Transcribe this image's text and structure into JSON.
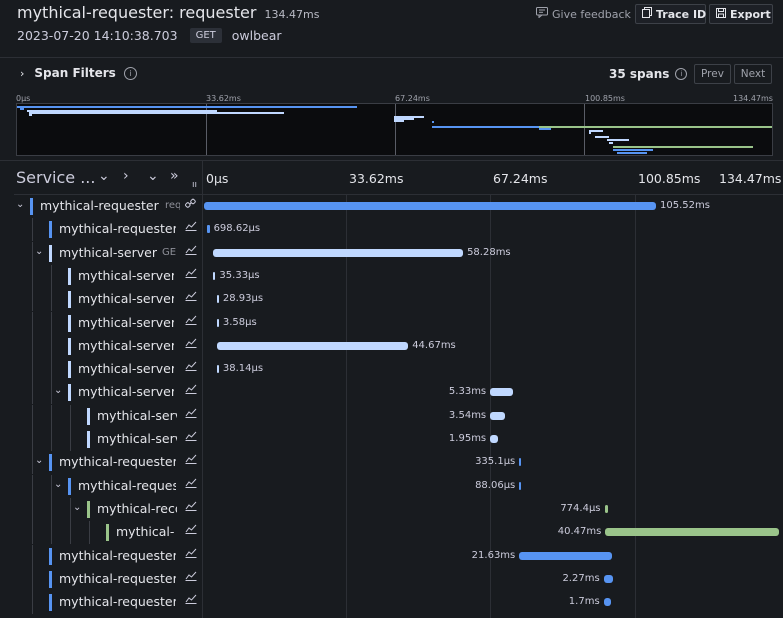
{
  "header": {
    "title": "mythical-requester: requester",
    "duration": "134.47ms",
    "timestamp": "2023-07-20 14:10:38.703",
    "method": "GET",
    "service_tag": "owlbear",
    "feedback_label": "Give feedback",
    "trace_id_label": "Trace ID",
    "export_label": "Export"
  },
  "filters": {
    "label": "Span Filters",
    "span_count": "35 spans",
    "prev_label": "Prev",
    "next_label": "Next"
  },
  "minimap_ticks": [
    "0μs",
    "33.62ms",
    "67.24ms",
    "100.85ms",
    "134.47ms"
  ],
  "columns": {
    "service_title": "Service ...",
    "ticks": [
      "0μs",
      "33.62ms",
      "67.24ms",
      "100.85ms",
      "134.47ms"
    ]
  },
  "colors": {
    "requester": "#5794f2",
    "server": "#c0d8ff",
    "recorder": "#9ac48a"
  },
  "rows": [
    {
      "service": "mythical-requester",
      "operation": "requester",
      "duration": "105.52ms",
      "color": "#5794f2",
      "start_ms": 0,
      "expanded": true,
      "icon": "link-icon"
    },
    {
      "service": "mythical-requester",
      "operation": "",
      "duration": "698.62μs",
      "color": "#5794f2",
      "start_ms": 0.6,
      "icon": "chart-icon"
    },
    {
      "service": "mythical-server",
      "operation": "GE",
      "duration": "58.28ms",
      "color": "#c0d8ff",
      "start_ms": 2.2,
      "expanded": true,
      "icon": "chart-icon"
    },
    {
      "service": "mythical-server",
      "operation": "",
      "duration": "35.33μs",
      "color": "#c0d8ff",
      "start_ms": 2.2,
      "icon": "chart-icon"
    },
    {
      "service": "mythical-server",
      "operation": "",
      "duration": "28.93μs",
      "color": "#c0d8ff",
      "start_ms": 3.0,
      "icon": "chart-icon"
    },
    {
      "service": "mythical-server",
      "operation": "",
      "duration": "3.58μs",
      "color": "#c0d8ff",
      "start_ms": 3.0,
      "icon": "chart-icon"
    },
    {
      "service": "mythical-server",
      "operation": "",
      "duration": "44.67ms",
      "color": "#c0d8ff",
      "start_ms": 3.0,
      "icon": "chart-icon"
    },
    {
      "service": "mythical-server",
      "operation": "",
      "duration": "38.14μs",
      "color": "#c0d8ff",
      "start_ms": 3.0,
      "icon": "chart-icon"
    },
    {
      "service": "mythical-server",
      "operation": "",
      "duration": "5.33ms",
      "color": "#c0d8ff",
      "start_ms": 66.8,
      "expanded": true,
      "icon": "chart-icon"
    },
    {
      "service": "mythical-serv",
      "operation": "",
      "duration": "3.54ms",
      "color": "#c0d8ff",
      "start_ms": 66.8,
      "icon": "chart-icon"
    },
    {
      "service": "mythical-serv",
      "operation": "",
      "duration": "1.95ms",
      "color": "#c0d8ff",
      "start_ms": 66.8,
      "icon": "chart-icon"
    },
    {
      "service": "mythical-requester",
      "operation": "",
      "duration": "335.1μs",
      "color": "#5794f2",
      "start_ms": 73.6,
      "expanded": true,
      "icon": "chart-icon"
    },
    {
      "service": "mythical-reques",
      "operation": "",
      "duration": "88.06μs",
      "color": "#5794f2",
      "start_ms": 73.6,
      "expanded": true,
      "icon": "chart-icon"
    },
    {
      "service": "mythical-reco",
      "operation": "",
      "duration": "774.4μs",
      "color": "#9ac48a",
      "start_ms": 93.5,
      "expanded": true,
      "icon": "chart-icon"
    },
    {
      "service": "mythical-",
      "operation": "",
      "duration": "40.47ms",
      "color": "#9ac48a",
      "start_ms": 93.7,
      "icon": "chart-icon"
    },
    {
      "service": "mythical-requester",
      "operation": "",
      "duration": "21.63ms",
      "color": "#5794f2",
      "start_ms": 73.6,
      "icon": "chart-icon"
    },
    {
      "service": "mythical-requester",
      "operation": "",
      "duration": "2.27ms",
      "color": "#5794f2",
      "start_ms": 93.3,
      "icon": "chart-icon"
    },
    {
      "service": "mythical-requester",
      "operation": "",
      "duration": "1.7ms",
      "color": "#5794f2",
      "start_ms": 93.3,
      "icon": "chart-icon"
    }
  ]
}
